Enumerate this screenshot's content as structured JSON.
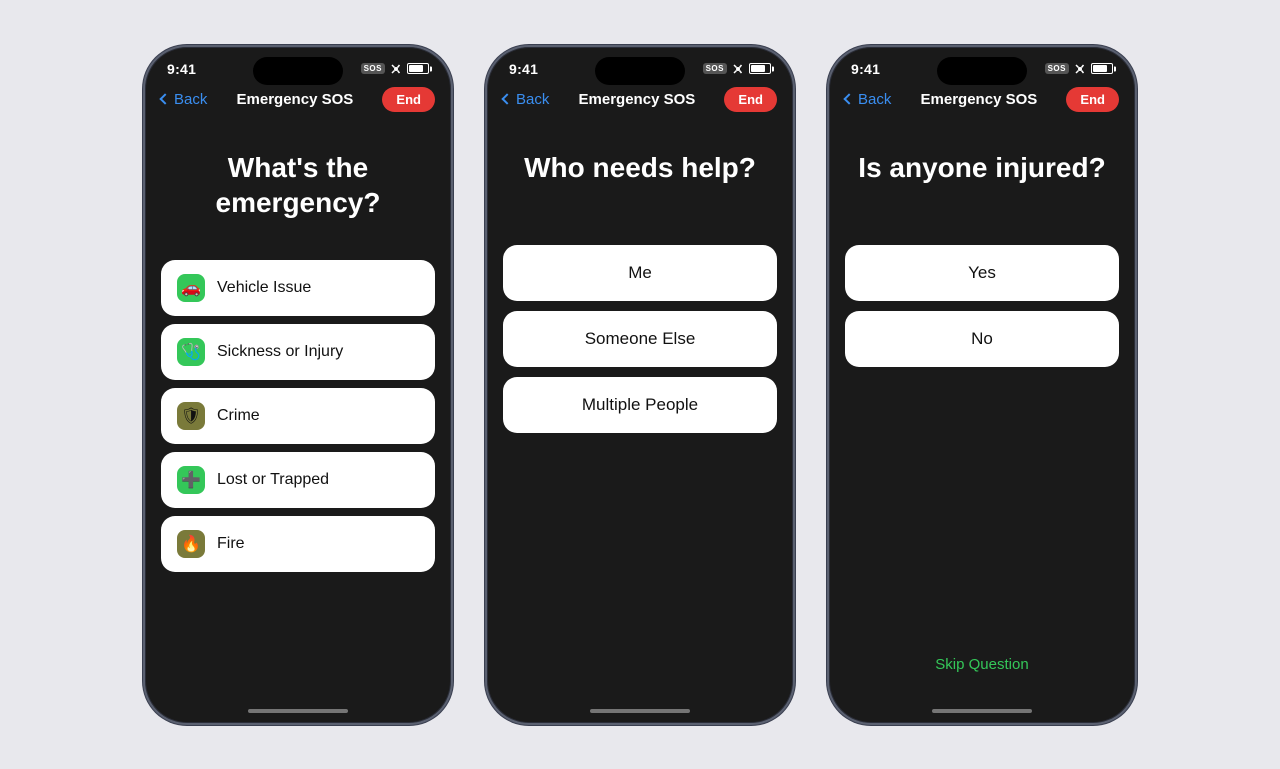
{
  "background": "#e8e8ed",
  "phones": [
    {
      "id": "phone-emergency-type",
      "statusBar": {
        "time": "9:41",
        "sos": "SOS",
        "battery": 80
      },
      "nav": {
        "back": "Back",
        "title": "Emergency SOS",
        "end": "End"
      },
      "question": "What's the emergency?",
      "options": [
        {
          "label": "Vehicle Issue",
          "icon": "🚗",
          "iconBg": "green"
        },
        {
          "label": "Sickness or Injury",
          "icon": "🩺",
          "iconBg": "green"
        },
        {
          "label": "Crime",
          "icon": "🛡",
          "iconBg": "olive"
        },
        {
          "label": "Lost or Trapped",
          "icon": "➕",
          "iconBg": "green"
        },
        {
          "label": "Fire",
          "icon": "🔥",
          "iconBg": "olive"
        }
      ]
    },
    {
      "id": "phone-who-needs-help",
      "statusBar": {
        "time": "9:41",
        "sos": "SOS",
        "battery": 80
      },
      "nav": {
        "back": "Back",
        "title": "Emergency SOS",
        "end": "End"
      },
      "question": "Who needs help?",
      "options": [
        {
          "label": "Me"
        },
        {
          "label": "Someone Else"
        },
        {
          "label": "Multiple People"
        }
      ]
    },
    {
      "id": "phone-injured",
      "statusBar": {
        "time": "9:41",
        "sos": "SOS",
        "battery": 80
      },
      "nav": {
        "back": "Back",
        "title": "Emergency SOS",
        "end": "End"
      },
      "question": "Is anyone injured?",
      "options": [
        {
          "label": "Yes"
        },
        {
          "label": "No"
        }
      ],
      "skipLabel": "Skip Question"
    }
  ]
}
